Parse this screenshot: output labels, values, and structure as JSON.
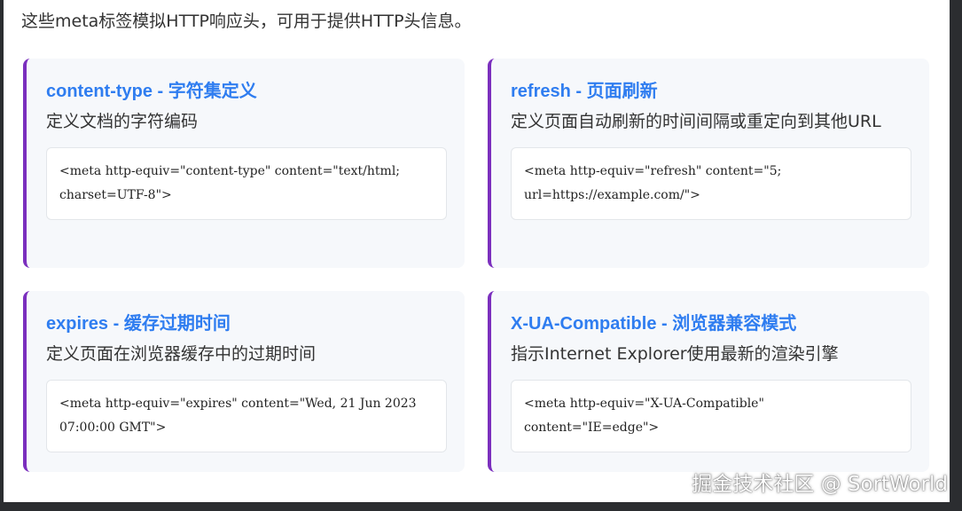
{
  "intro": "这些meta标签模拟HTTP响应头，可用于提供HTTP头信息。",
  "cards": [
    {
      "title": "content-type - 字符集定义",
      "desc": "定义文档的字符编码",
      "code": "<meta http-equiv=\"content-type\" content=\"text/html; charset=UTF-8\">"
    },
    {
      "title": "refresh - 页面刷新",
      "desc": "定义页面自动刷新的时间间隔或重定向到其他URL",
      "code": "<meta http-equiv=\"refresh\" content=\"5; url=https://example.com/\">"
    },
    {
      "title": "expires - 缓存过期时间",
      "desc": "定义页面在浏览器缓存中的过期时间",
      "code": "<meta http-equiv=\"expires\" content=\"Wed, 21 Jun 2023 07:00:00 GMT\">"
    },
    {
      "title": "X-UA-Compatible - 浏览器兼容模式",
      "desc": "指示Internet Explorer使用最新的渲染引擎",
      "code": "<meta http-equiv=\"X-UA-Compatible\" content=\"IE=edge\">"
    }
  ],
  "watermark": "掘金技术社区 @ SortWorld",
  "colors": {
    "accent_border": "#7b2fbe",
    "title": "#2f7df0",
    "card_bg": "#f6f8fb"
  }
}
